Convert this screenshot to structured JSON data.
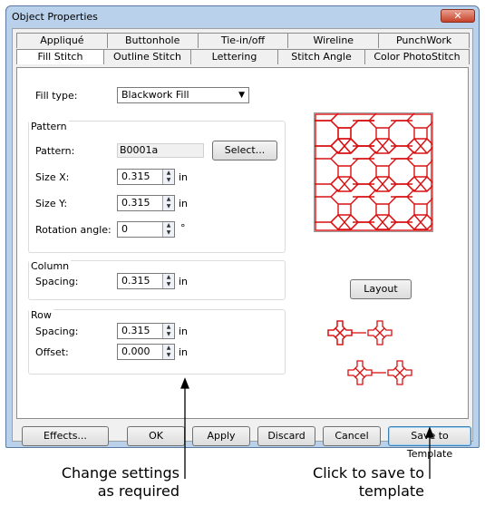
{
  "window": {
    "title": "Object Properties",
    "close_label": "✕"
  },
  "tabs_row1": [
    "Appliqué",
    "Buttonhole",
    "Tie-in/off",
    "Wireline",
    "PunchWork"
  ],
  "tabs_row2": [
    "Fill Stitch",
    "Outline Stitch",
    "Lettering",
    "Stitch Angle",
    "Color PhotoStitch"
  ],
  "fill_type": {
    "label": "Fill type:",
    "value": "Blackwork Fill"
  },
  "pattern_group": {
    "title": "Pattern",
    "pattern_label": "Pattern:",
    "pattern_value": "B0001a",
    "select_label": "Select...",
    "size_x_label": "Size X:",
    "size_x_value": "0.315",
    "size_x_unit": "in",
    "size_y_label": "Size Y:",
    "size_y_value": "0.315",
    "size_y_unit": "in",
    "rotation_label": "Rotation angle:",
    "rotation_value": "0",
    "rotation_unit": "°"
  },
  "column_group": {
    "title": "Column",
    "spacing_label": "Spacing:",
    "spacing_value": "0.315",
    "spacing_unit": "in"
  },
  "row_group": {
    "title": "Row",
    "spacing_label": "Spacing:",
    "spacing_value": "0.315",
    "spacing_unit": "in",
    "offset_label": "Offset:",
    "offset_value": "0.000",
    "offset_unit": "in"
  },
  "layout_button": "Layout",
  "buttons": {
    "effects": "Effects...",
    "ok": "OK",
    "apply": "Apply",
    "discard": "Discard",
    "cancel": "Cancel",
    "save_template": "Save to Template"
  },
  "callouts": {
    "left_line1": "Change settings",
    "left_line2": "as required",
    "right_line1": "Click to save to",
    "right_line2": "template"
  },
  "colors": {
    "stitch_red": "#d81010",
    "frame_blue": "#b9d1ea"
  }
}
